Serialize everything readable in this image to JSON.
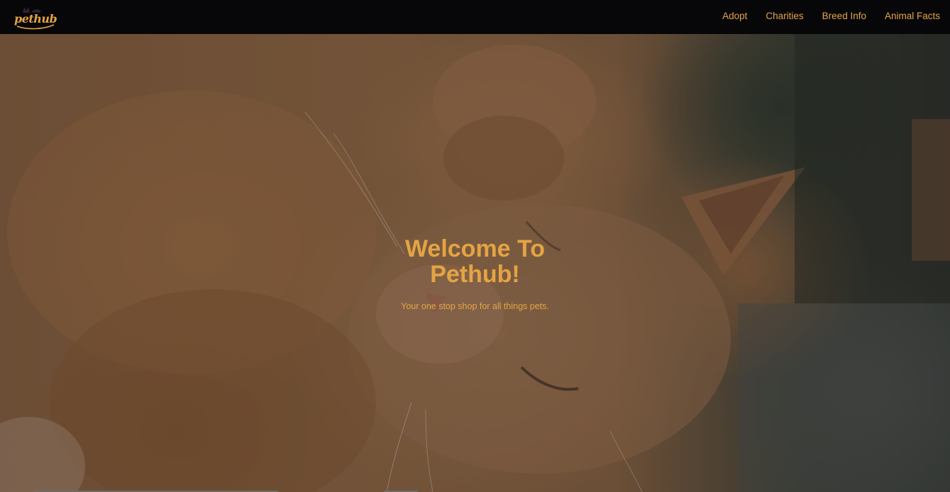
{
  "brand": {
    "logo_text": "pethub",
    "logo_icon": "cat-silhouette-logo"
  },
  "nav": {
    "items": [
      {
        "label": "Adopt"
      },
      {
        "label": "Charities"
      },
      {
        "label": "Breed Info"
      },
      {
        "label": "Animal Facts"
      }
    ]
  },
  "hero": {
    "title": "Welcome To Pethub!",
    "subtitle": "Your one stop shop for all things pets.",
    "background_image": "sleeping-orange-cat-photo"
  },
  "colors": {
    "accent": "#e4a443",
    "navbar_bg": "#07070a"
  }
}
